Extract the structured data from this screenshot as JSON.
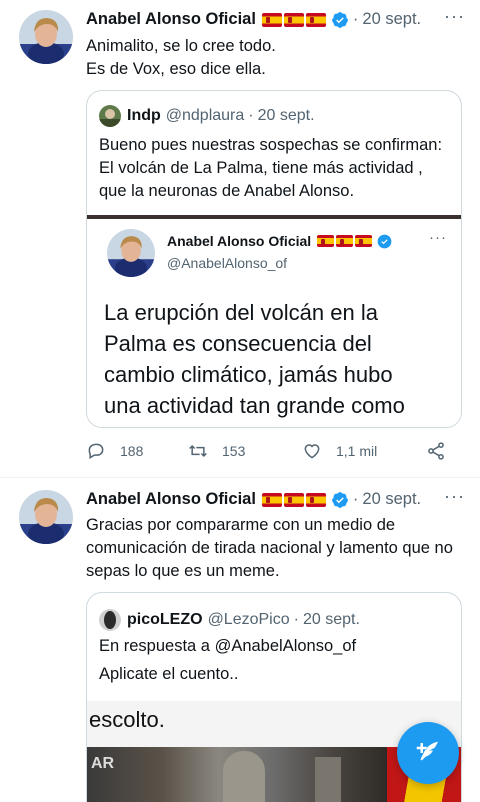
{
  "tweet1": {
    "author": "Anabel Alonso Oficial",
    "date": "20 sept.",
    "text": "Animalito, se lo cree todo.\nEs de Vox, eso dice ella.",
    "quote": {
      "author": "Indp",
      "handle": "@ndplaura",
      "date": "20 sept.",
      "text": "Bueno pues nuestras sospechas se confirman:\nEl  volcán de La Palma, tiene más actividad ,\n que la neuronas de Anabel Alonso.",
      "embedded": {
        "author": "Anabel Alonso Oficial",
        "handle": "@AnabelAlonso_of",
        "text": "La erupción del volcán en la\nPalma es consecuencia del\ncambio climático, jamás hubo\nuna actividad tan grande como\nen estos últimos años."
      }
    },
    "replies": "188",
    "retweets": "153",
    "likes": "1,1 mil"
  },
  "tweet2": {
    "author": "Anabel Alonso Oficial",
    "date": "20 sept.",
    "text": "Gracias por compararme con un medio de\ncomunicación de tirada nacional y lamento que no\nsepas lo que es un meme.",
    "quote": {
      "author": "picoLEZO",
      "handle": "@LezoPico",
      "date": "20 sept.",
      "reply_to": "En respuesta a @AnabelAlonso_of",
      "text": "Aplicate el cuento..",
      "image_text": "escolto.",
      "image_sign": "AR"
    }
  },
  "colors": {
    "accent": "#1d9bf0",
    "muted": "#536471",
    "border": "#cfd9de"
  }
}
